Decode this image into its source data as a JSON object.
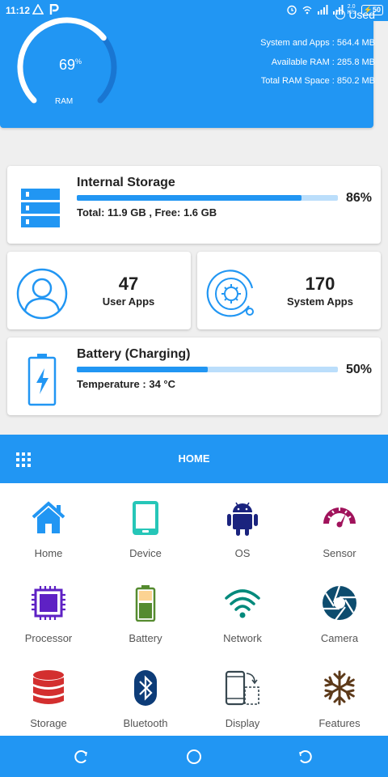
{
  "status_bar": {
    "time": "11:12",
    "network_speed": "2.0\nK/s",
    "battery_level": "50"
  },
  "ram": {
    "percent": "69",
    "percent_unit": "%",
    "percent_value": 69,
    "label": "RAM",
    "legend": "Used",
    "system_and_apps": "System and Apps : 564.4 MB",
    "available": "Available RAM : 285.8 MB",
    "total": "Total RAM Space : 850.2 MB"
  },
  "storage": {
    "title": "Internal Storage",
    "details": "Total:  11.9 GB ,  Free: 1.6 GB",
    "percent": "86%",
    "fill": 0.86
  },
  "user_apps": {
    "count": "47",
    "label": "User Apps"
  },
  "system_apps": {
    "count": "170",
    "label": "System Apps"
  },
  "battery": {
    "title": "Battery (Charging)",
    "temperature": "Temperature : 34 °C",
    "percent": "50%",
    "fill": 0.5
  },
  "home_bar": {
    "title": "HOME"
  },
  "menu": [
    {
      "label": "Home",
      "icon": "home-icon",
      "color": "#2196f3"
    },
    {
      "label": "Device",
      "icon": "tablet-icon",
      "color": "#26c6b8"
    },
    {
      "label": "OS",
      "icon": "android-icon",
      "color": "#1a237e"
    },
    {
      "label": "Sensor",
      "icon": "gauge-icon",
      "color": "#a0125b"
    },
    {
      "label": "Processor",
      "icon": "chip-icon",
      "color": "#5e21c4"
    },
    {
      "label": "Battery",
      "icon": "battery-icon",
      "color": "#558b2f"
    },
    {
      "label": "Network",
      "icon": "wifi-icon",
      "color": "#00897b"
    },
    {
      "label": "Camera",
      "icon": "camera-aperture-icon",
      "color": "#0d4c6e"
    },
    {
      "label": "Storage",
      "icon": "database-icon",
      "color": "#d32f2f"
    },
    {
      "label": "Bluetooth",
      "icon": "bluetooth-icon",
      "color": "#0d3c78"
    },
    {
      "label": "Display",
      "icon": "display-rotate-icon",
      "color": "#37474f"
    },
    {
      "label": "Features",
      "icon": "snowflake-icon",
      "color": "#5d3a1a"
    }
  ],
  "colors": {
    "primary": "#2196f3",
    "track": "#bbdefb"
  }
}
